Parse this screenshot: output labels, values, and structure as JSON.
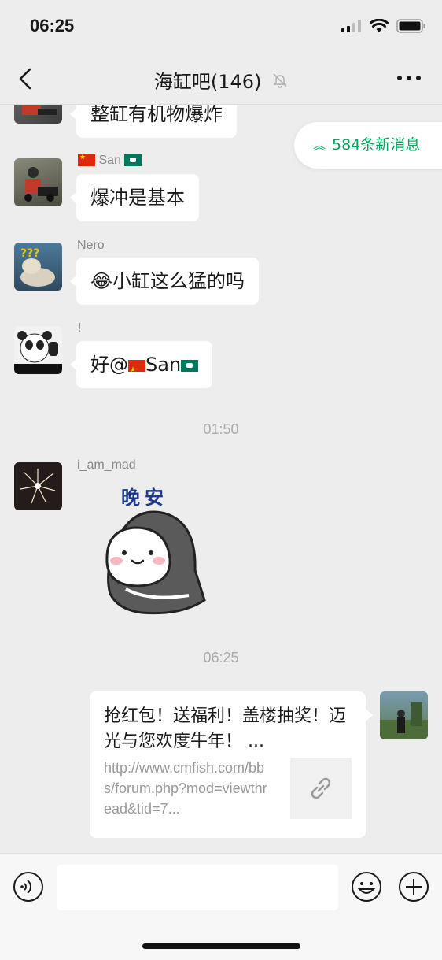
{
  "status_bar": {
    "time": "06:25"
  },
  "header": {
    "title": "海缸吧(146)"
  },
  "new_messages": {
    "label": "584条新消息"
  },
  "messages": [
    {
      "sender": "",
      "text": "整缸有机物爆炸"
    },
    {
      "sender_name": "San",
      "text": "爆冲是基本"
    },
    {
      "sender": "Nero",
      "text": "😂小缸这么猛的吗"
    },
    {
      "sender": "!",
      "text_prefix": "好@",
      "mention_name": "San"
    },
    {
      "sender": "i_am_mad",
      "sticker_text": "晚安"
    }
  ],
  "time_separators": [
    "01:50",
    "06:25"
  ],
  "link_card": {
    "title": "抢红包！送福利！盖楼抽奖！迈光与您欢度牛年！ ...",
    "url": "http://www.cmfish.com/bbs/forum.php?mod=viewthread&tid=7..."
  },
  "input": {
    "placeholder": ""
  },
  "colors": {
    "accent": "#07a35a",
    "background": "#ededed",
    "bubble": "#ffffff"
  }
}
